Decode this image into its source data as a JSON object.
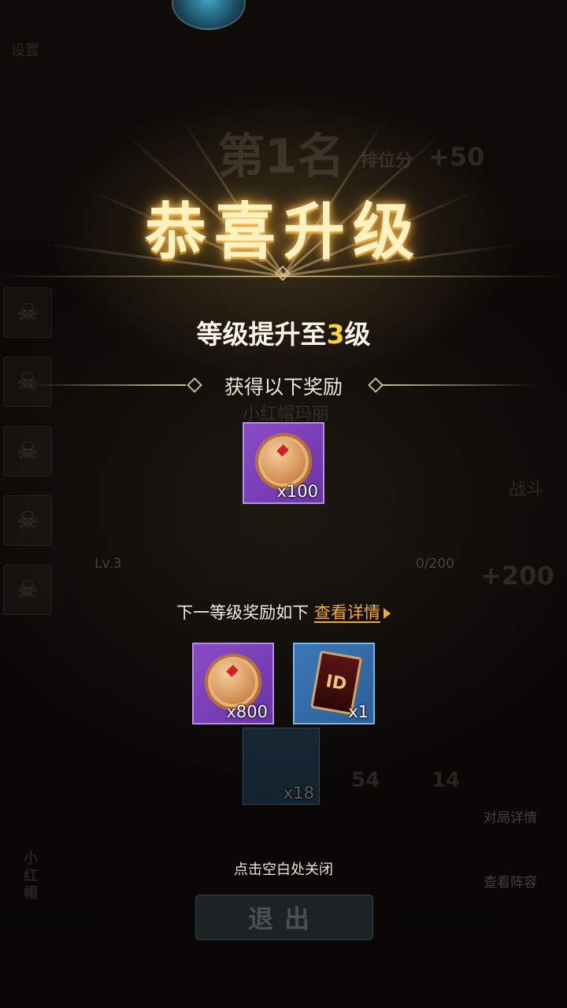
{
  "background": {
    "rank_text": "第1名",
    "rank_score_label": "排位分",
    "rank_score_delta": "+50",
    "corner_label": "设置",
    "hero_name": "小红帽玛丽",
    "battle_label": "战斗",
    "level_label": "Lv.3",
    "xp_text": "0/200",
    "xp_delta": "+200",
    "match_details_label": "对局详情",
    "view_lineup_label": "查看阵容",
    "chest_qty": "x18",
    "score_row": "54",
    "score_row_2": "14",
    "exit_label": "退出",
    "side_name": "小红帽"
  },
  "popup": {
    "title": "恭喜升级",
    "level_prefix": "等级提升至",
    "level_value": "3",
    "level_suffix": "级",
    "rewards_heading": "获得以下奖励",
    "rewards": [
      {
        "icon": "coin-icon",
        "qty": "x100"
      }
    ],
    "next_prefix": "下一等级奖励如下",
    "next_link": "查看详情",
    "next_rewards": [
      {
        "icon": "coin-icon",
        "qty": "x800"
      },
      {
        "icon": "id-card-icon",
        "card_text": "ID",
        "qty": "x1"
      }
    ],
    "close_hint": "点击空白处关闭"
  },
  "colors": {
    "highlight": "#ffd23c",
    "link": "#f5a92d",
    "purple_item": "#7a40b8",
    "blue_item": "#3369a6"
  }
}
